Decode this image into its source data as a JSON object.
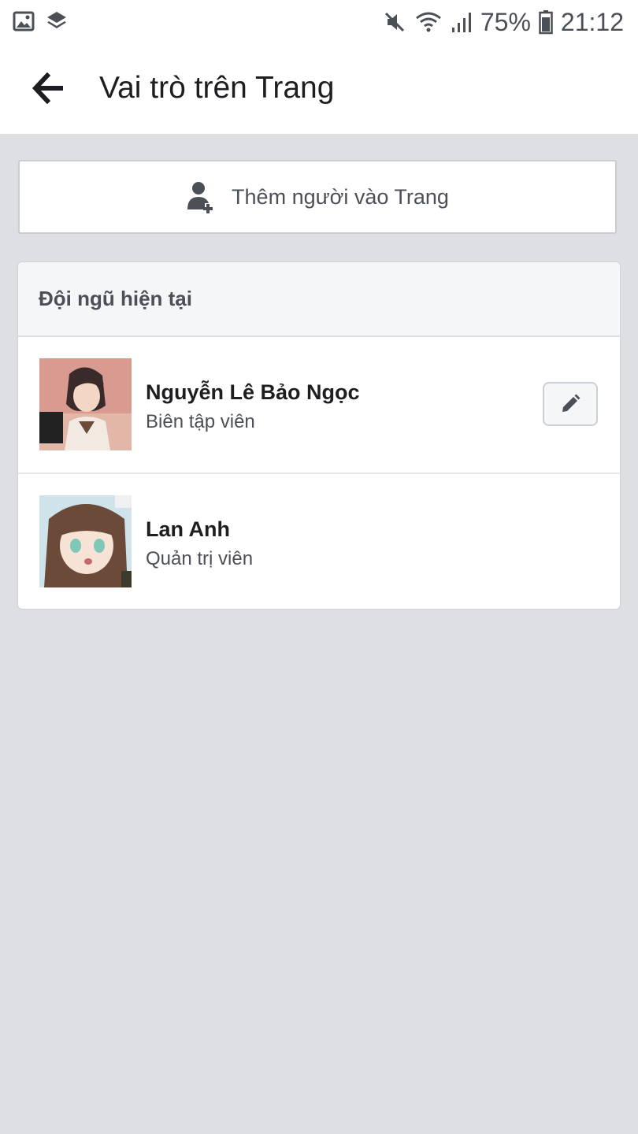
{
  "status_bar": {
    "battery_percent": "75%",
    "time": "21:12",
    "icons": [
      "image-icon",
      "layers-icon",
      "mute-icon",
      "wifi-icon",
      "signal-icon",
      "battery-icon"
    ]
  },
  "header": {
    "title": "Vai trò trên Trang",
    "back_icon": "back-arrow-icon"
  },
  "add_person": {
    "label": "Thêm người vào Trang",
    "icon": "add-person-icon"
  },
  "team": {
    "title": "Đội ngũ hiện tại",
    "members": [
      {
        "name": "Nguyễn Lê Bảo Ngọc",
        "role": "Biên tập viên",
        "editable": true,
        "edit_icon": "pencil-icon"
      },
      {
        "name": "Lan Anh",
        "role": "Quản trị viên",
        "editable": false
      }
    ]
  },
  "colors": {
    "background": "#dddfe3",
    "surface": "#ffffff",
    "text_primary": "#1c1e21",
    "text_secondary": "#4b4f56",
    "header_bg": "#f5f6f8"
  }
}
